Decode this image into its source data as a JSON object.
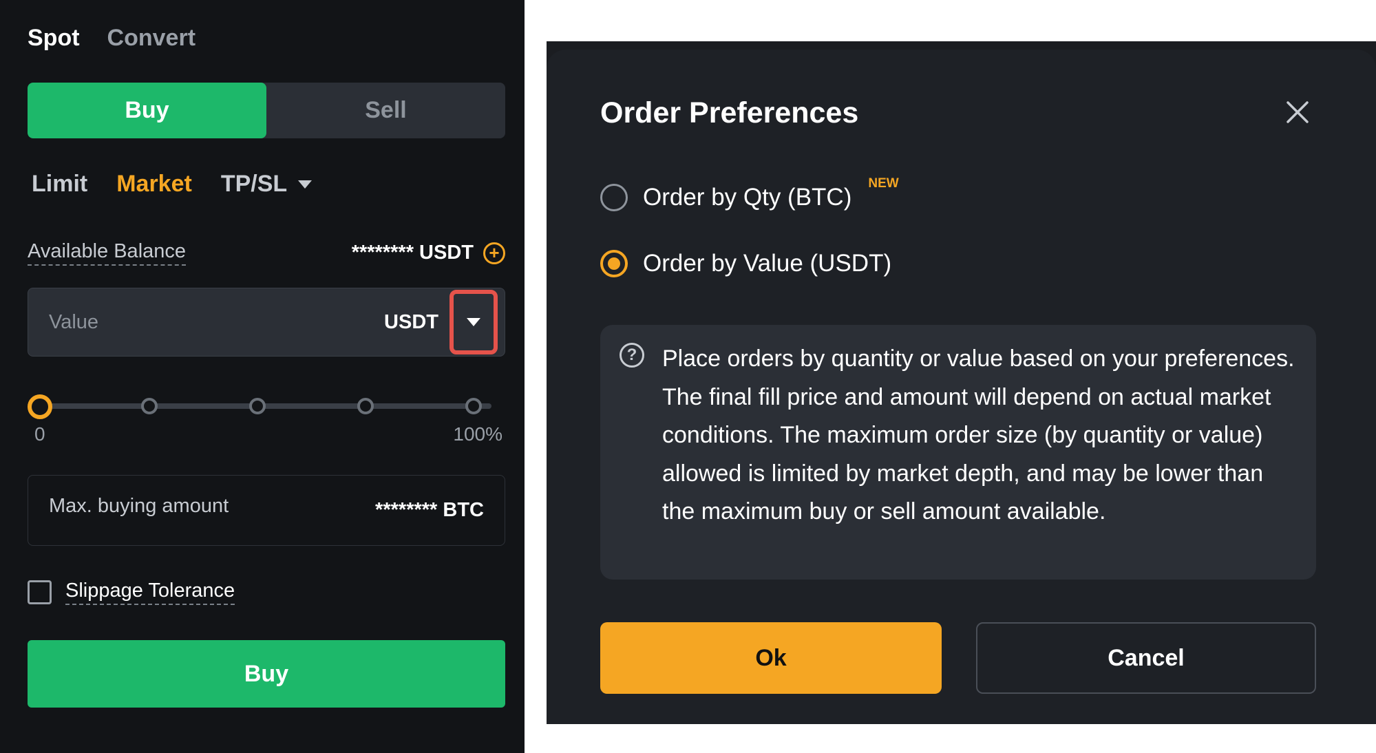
{
  "trade_panel": {
    "tabs": [
      {
        "label": "Spot",
        "active": true
      },
      {
        "label": "Convert",
        "active": false
      }
    ],
    "side_toggle": {
      "buy_label": "Buy",
      "sell_label": "Sell",
      "selected": "Buy"
    },
    "order_types": [
      {
        "label": "Limit",
        "active": false
      },
      {
        "label": "Market",
        "active": true
      },
      {
        "label": "TP/SL",
        "active": false,
        "has_dropdown": true
      }
    ],
    "available_balance": {
      "label": "Available Balance",
      "value": "******** USDT",
      "add_icon": "plus-circle-icon"
    },
    "value_input": {
      "placeholder": "Value",
      "unit": "USDT",
      "unit_dropdown_icon": "caret-down-icon"
    },
    "slider": {
      "min_label": "0",
      "max_label": "100%",
      "value_fraction": 0,
      "stops": 5
    },
    "max_buying": {
      "label": "Max. buying amount",
      "value": "******** BTC"
    },
    "slippage": {
      "label": "Slippage Tolerance",
      "checked": false
    },
    "submit_label": "Buy"
  },
  "order_preferences_modal": {
    "title": "Order Preferences",
    "close_icon": "close-icon",
    "options": [
      {
        "label": "Order by Qty (BTC)",
        "badge": "NEW",
        "selected": false
      },
      {
        "label": "Order by Value (USDT)",
        "badge": "",
        "selected": true
      }
    ],
    "info_icon": "question-circle-icon",
    "info_text": "Place orders by quantity or value based on your preferences. The final fill price and amount will depend on actual market conditions. The maximum order size (by quantity or value) allowed is limited by market depth, and may be lower than the maximum buy or sell amount available.",
    "ok_label": "Ok",
    "cancel_label": "Cancel"
  },
  "colors": {
    "buy_green": "#1db86a",
    "accent_orange": "#f5a623",
    "highlight_red": "#e5534b",
    "panel_bg": "#121417",
    "modal_bg": "#1e2126"
  }
}
